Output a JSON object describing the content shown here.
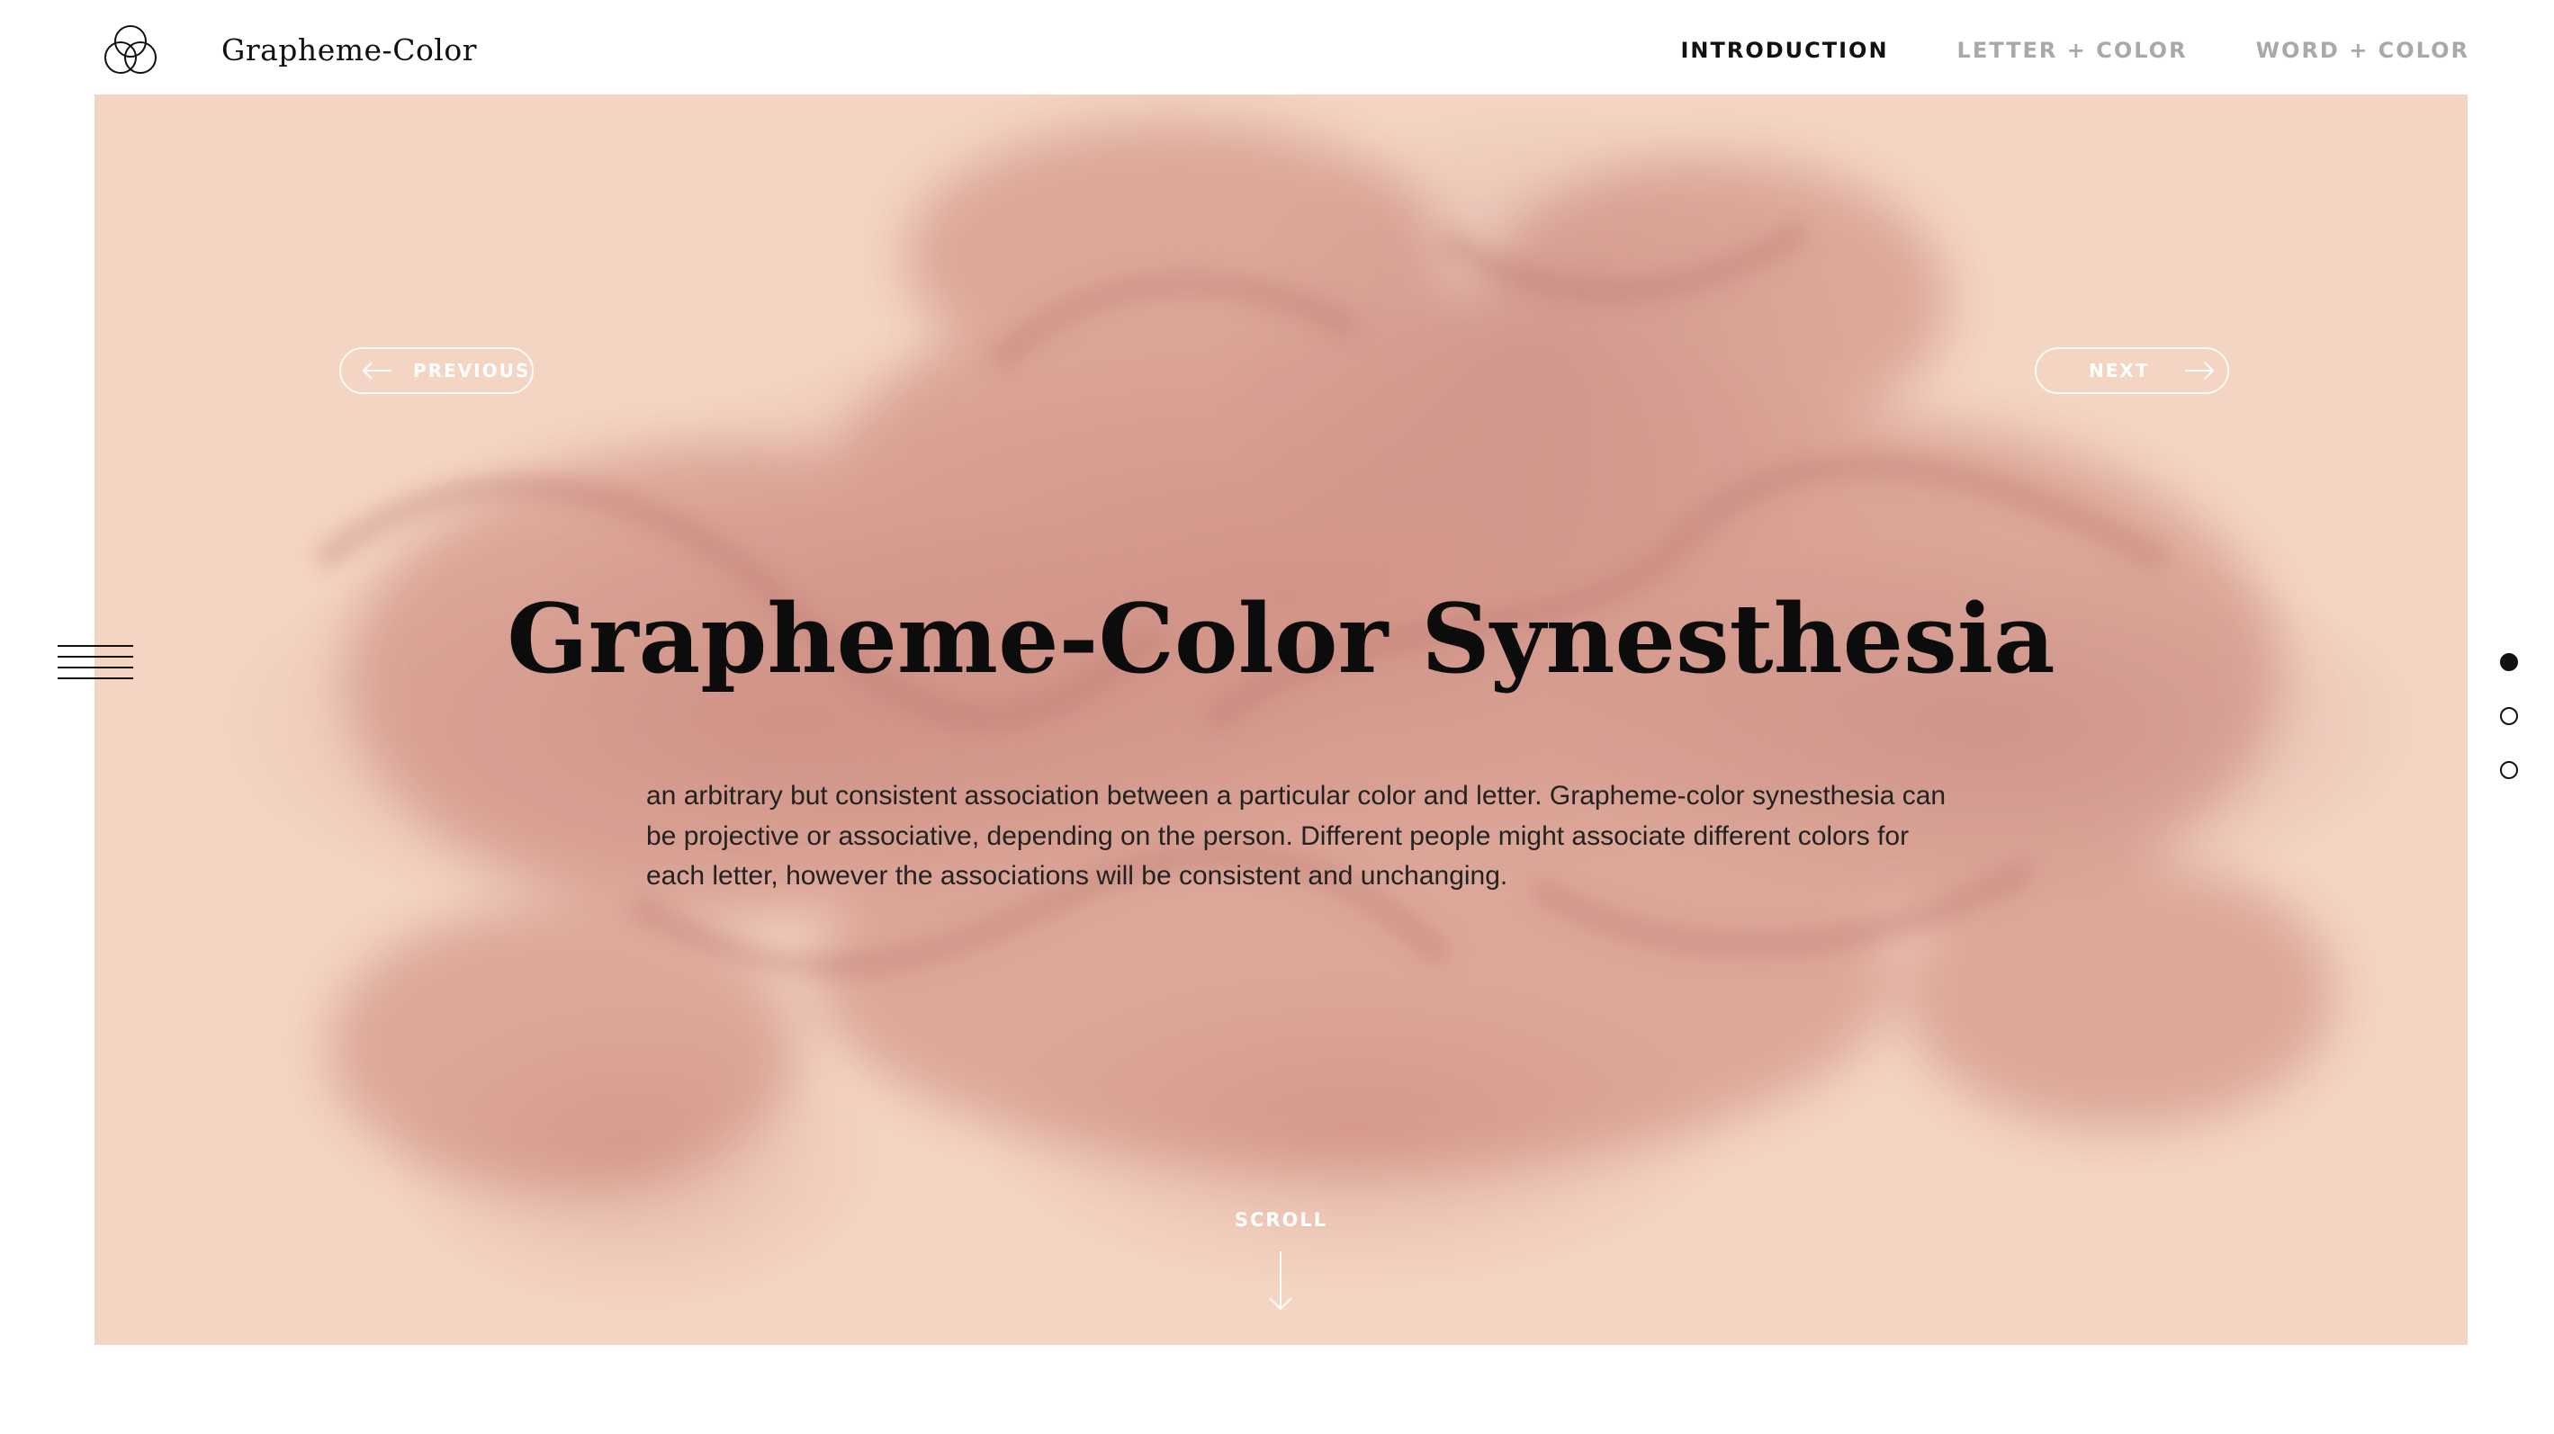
{
  "header": {
    "brand": "Grapheme-Color",
    "logo_icon": "three-circles-logo-icon",
    "nav": [
      {
        "label": "INTRODUCTION",
        "active": true
      },
      {
        "label": "LETTER + COLOR",
        "active": false
      },
      {
        "label": "WORD + COLOR",
        "active": false
      }
    ]
  },
  "hero": {
    "background_color": "#f4d4c2",
    "previous_label": "PREVIOUS",
    "next_label": "NEXT",
    "title": "Grapheme-Color Synesthesia",
    "description": "an arbitrary but consistent association between a particular color and letter. Grapheme-color synesthesia can be projective or associative, depending on the person. Different people might associate different colors for each letter, however the associations will be consistent and unchanging.",
    "scroll_label": "SCROLL"
  },
  "side": {
    "menu_icon": "hamburger-menu-icon",
    "pager": {
      "count": 3,
      "active_index": 0
    }
  }
}
